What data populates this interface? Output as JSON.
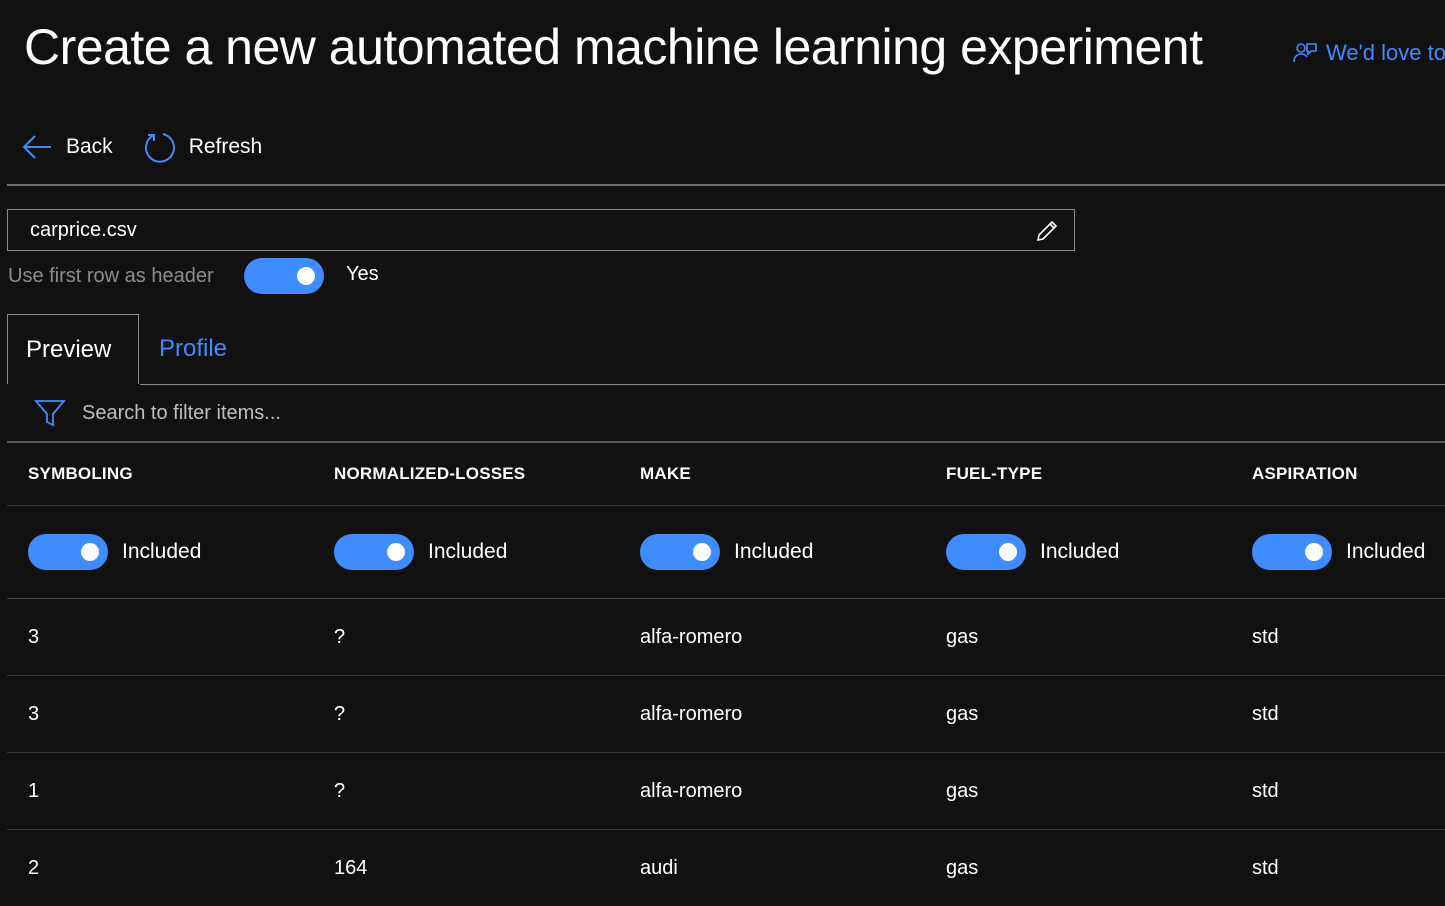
{
  "page": {
    "title": "Create a new automated machine learning experiment",
    "feedback_label": "We'd love to"
  },
  "toolbar": {
    "back_label": "Back",
    "refresh_label": "Refresh"
  },
  "dataset": {
    "file_name": "carprice.csv",
    "header_toggle_label": "Use first row as header",
    "header_toggle_value": "Yes",
    "header_toggle_on": true
  },
  "tabs": [
    {
      "label": "Preview",
      "active": true
    },
    {
      "label": "Profile",
      "active": false
    }
  ],
  "search": {
    "placeholder": "Search to filter items..."
  },
  "table": {
    "columns": [
      {
        "header": "SYMBOLING",
        "status": "Included",
        "included": true
      },
      {
        "header": "NORMALIZED-LOSSES",
        "status": "Included",
        "included": true
      },
      {
        "header": "MAKE",
        "status": "Included",
        "included": true
      },
      {
        "header": "FUEL-TYPE",
        "status": "Included",
        "included": true
      },
      {
        "header": "ASPIRATION",
        "status": "Included",
        "included": true
      }
    ],
    "rows": [
      [
        "3",
        "?",
        "alfa-romero",
        "gas",
        "std"
      ],
      [
        "3",
        "?",
        "alfa-romero",
        "gas",
        "std"
      ],
      [
        "1",
        "?",
        "alfa-romero",
        "gas",
        "std"
      ],
      [
        "2",
        "164",
        "audi",
        "gas",
        "std"
      ]
    ]
  },
  "colors": {
    "background": "#111111",
    "accent": "#3f8cff",
    "muted_text": "#8c8c8c"
  },
  "icons": {
    "back": "arrow-left-icon",
    "refresh": "refresh-icon",
    "edit": "pencil-icon",
    "filter": "filter-icon",
    "feedback": "feedback-person-icon"
  }
}
